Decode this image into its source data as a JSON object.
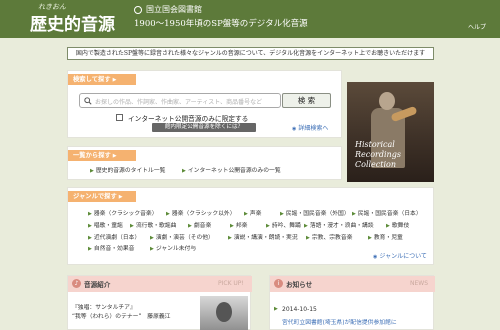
{
  "header": {
    "logo_small": "れきおん",
    "logo_main": "歴史的音源",
    "org_name": "国立国会図書館",
    "subtitle": "1900～1950年頃のSP盤等のデジタル化音源",
    "help": "ヘルプ"
  },
  "banner": "国内で製造されたSP盤等に録音された様々なジャンルの音源について、デジタル化音源をインターネット上でお聴きいただけます",
  "search": {
    "label": "検索して探す",
    "placeholder": "お探しの作品、作詞家、作曲家、アーティスト、商品番号など",
    "button": "検 索",
    "checkbox_label": "インターネット公開音源のみに限定する",
    "limited_button": "館内限定公開音源を除くには？",
    "advanced": "詳細検索へ"
  },
  "list": {
    "label": "一覧から探す",
    "items": [
      "歴史的音源のタイトル一覧",
      "インターネット公開音源のみの一覧"
    ]
  },
  "photo": {
    "caption": "Historical Recordings Collection"
  },
  "genre": {
    "label": "ジャンルで探す",
    "items": [
      "器楽（クラシック音楽）",
      "器楽（クラシック以外）",
      "声楽",
      "民謡・国民音楽（外国）",
      "民謡・国民音楽（日本）",
      "唱歌・童謡",
      "流行歌・歌謡曲",
      "劇音楽",
      "邦楽",
      "詩吟、舞踊",
      "落語・漫才・浪曲・講談",
      "歌舞伎",
      "近代演劇（日本）",
      "演劇・演芸（その他）",
      "演説・講演・朗読・実況",
      "宗教、宗教音楽",
      "教育・児童",
      "自然音・効果音",
      "ジャンル未付与"
    ],
    "more": "ジャンルについて"
  },
  "intro": {
    "title": "音源紹介",
    "tag": "PICK UP!",
    "line1": "『独唱：サンタルチア』",
    "line2": "“我等（われら）のテナー”　藤原義江"
  },
  "news": {
    "title": "お知らせ",
    "tag": "NEWS",
    "date": "2014-10-15",
    "text": "宮代町立図書館(埼玉県)が配信提供参加館に"
  },
  "colors": {
    "header": "#5d7a3a",
    "label_orange": "#f5b270",
    "background": "#e9ecdb",
    "link_blue": "#3d6fb6"
  }
}
